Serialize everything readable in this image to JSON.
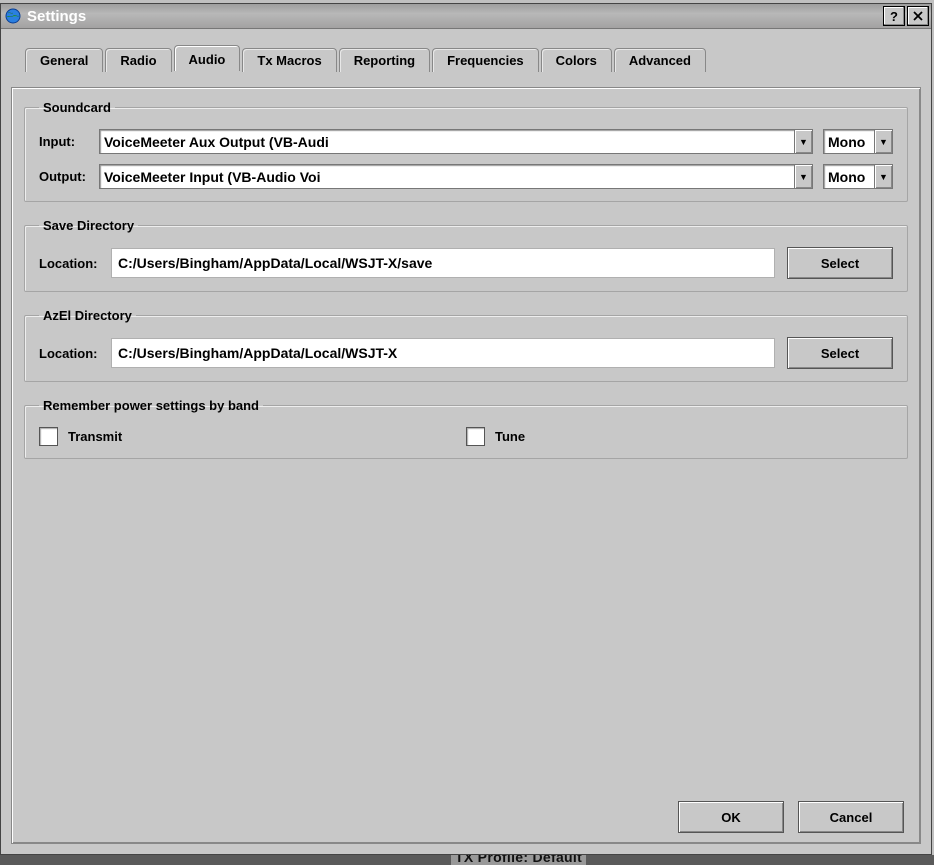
{
  "window": {
    "title": "Settings",
    "help_glyph": "?",
    "close_glyph": "✕"
  },
  "tabs": [
    {
      "label": "General"
    },
    {
      "label": "Radio"
    },
    {
      "label": "Audio"
    },
    {
      "label": "Tx Macros"
    },
    {
      "label": "Reporting"
    },
    {
      "label": "Frequencies"
    },
    {
      "label": "Colors"
    },
    {
      "label": "Advanced"
    }
  ],
  "active_tab": "Audio",
  "soundcard": {
    "legend": "Soundcard",
    "input_label": "Input:",
    "input_value": "VoiceMeeter Aux Output (VB-Audi",
    "input_mode": "Mono",
    "output_label": "Output:",
    "output_value": "VoiceMeeter Input (VB-Audio Voi",
    "output_mode": "Mono"
  },
  "save_dir": {
    "legend": "Save Directory",
    "location_label": "Location:",
    "value": "C:/Users/Bingham/AppData/Local/WSJT-X/save",
    "select_label": "Select"
  },
  "azel_dir": {
    "legend": "AzEl Directory",
    "location_label": "Location:",
    "value": "C:/Users/Bingham/AppData/Local/WSJT-X",
    "select_label": "Select"
  },
  "power": {
    "legend": "Remember power settings by band",
    "transmit_label": "Transmit",
    "transmit_checked": false,
    "tune_label": "Tune",
    "tune_checked": false
  },
  "buttons": {
    "ok": "OK",
    "cancel": "Cancel"
  },
  "bg_hint": {
    "txprofile": "TX Profile:   Default"
  }
}
